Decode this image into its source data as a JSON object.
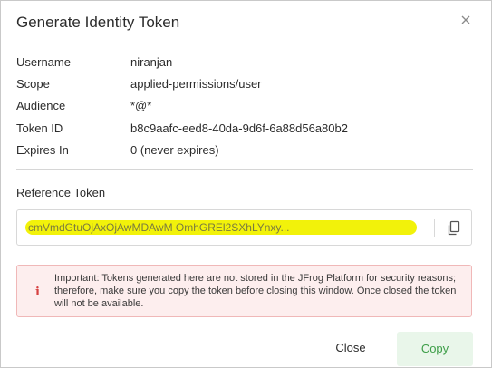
{
  "dialog": {
    "title": "Generate Identity Token",
    "close_icon": "close-icon"
  },
  "details": [
    {
      "label": "Username",
      "value": "niranjan"
    },
    {
      "label": "Scope",
      "value": "applied-permissions/user"
    },
    {
      "label": "Audience",
      "value": "*@*"
    },
    {
      "label": "Token ID",
      "value": "b8c9aafc-eed8-40da-9d6f-6a88d56a80b2"
    },
    {
      "label": "Expires In",
      "value": "0 (never expires)"
    }
  ],
  "reference_token": {
    "label": "Reference Token",
    "value": "cmVmdGtuOjAxOjAwMDAwM                              OmhGREl2SXhLYnxy...",
    "highlight_color": "#f2f20a",
    "copy_icon": "copy-icon"
  },
  "warning": {
    "icon": "info-icon",
    "text": "Important: Tokens generated here are not stored in the JFrog Platform for security reasons; therefore, make sure you copy the token before closing this window. Once closed the token will not be available."
  },
  "footer": {
    "close_label": "Close",
    "copy_label": "Copy",
    "accent_color": "#3d9e48"
  }
}
